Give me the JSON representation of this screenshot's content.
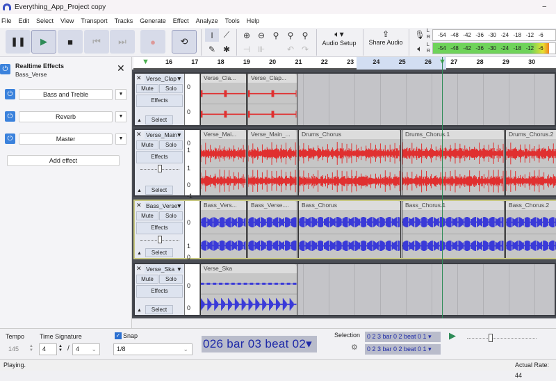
{
  "window": {
    "title": "Everything_App_Project copy",
    "minimize": "–"
  },
  "menu": [
    "File",
    "Edit",
    "Select",
    "View",
    "Transport",
    "Tracks",
    "Generate",
    "Effect",
    "Analyze",
    "Tools",
    "Help"
  ],
  "toolbar": {
    "audio_setup": "Audio Setup",
    "share_audio": "Share Audio",
    "meter_ticks": [
      "-54",
      "-48",
      "-42",
      "-36",
      "-30",
      "-24",
      "-18",
      "-12",
      "-6"
    ],
    "meter_channels": [
      "L",
      "R"
    ],
    "playback_level": 0.95
  },
  "ruler": {
    "ticks": [
      "16",
      "17",
      "18",
      "19",
      "20",
      "21",
      "22",
      "23",
      "24",
      "25",
      "26",
      "27",
      "28",
      "29",
      "30"
    ]
  },
  "realtime_effects": {
    "title": "Realtime Effects",
    "track": "Bass_Verse",
    "effects": [
      "Bass and Treble",
      "Reverb",
      "Master"
    ],
    "add_effect": "Add effect"
  },
  "tracks": [
    {
      "name": "Verse_Clap",
      "color": "#e03030",
      "mute": "Mute",
      "solo": "Solo",
      "effects": "Effects",
      "select": "Select",
      "scale": [
        "0",
        "0"
      ],
      "clips": [
        "Verse_Cla...",
        "Verse_Clap..."
      ]
    },
    {
      "name": "Verse_Main",
      "color": "#e03030",
      "mute": "Mute",
      "solo": "Solo",
      "effects": "Effects",
      "select": "Select",
      "scale": [
        "1",
        "0",
        "1",
        "0",
        "-1"
      ],
      "clips": [
        "Verse_Mai...",
        "Verse_Main_...",
        "Drums_Chorus",
        "Drums_Chorus.1",
        "Drums_Chorus.2"
      ]
    },
    {
      "name": "Bass_Verse",
      "color": "#3a3ad8",
      "mute": "Mute",
      "solo": "Solo",
      "effects": "Effects",
      "select": "Select",
      "scale": [
        "0",
        "1",
        "0"
      ],
      "clips": [
        "Bass_Vers...",
        "Bass_Verse....",
        "Bass_Chorus",
        "Bass_Chorus.1",
        "Bass_Chorus.2"
      ]
    },
    {
      "name": "Verse_Ska",
      "color": "#3a3ad8",
      "mute": "Mute",
      "solo": "Solo",
      "effects": "Effects",
      "select": "Select",
      "scale": [
        "0",
        "0"
      ],
      "clips": [
        "Verse_Ska"
      ]
    }
  ],
  "bottom": {
    "tempo_label": "Tempo",
    "tempo": "145",
    "timesig_label": "Time Signature",
    "timesig_num": "4",
    "timesig_sep": "/",
    "timesig_den": "4",
    "snap_label": "Snap",
    "snap_checked": true,
    "snap_value": "1/8",
    "time": "026 bar 03 beat 02",
    "selection_label": "Selection",
    "sel_start": "0 2 3 bar 0 2 beat 0 1",
    "sel_end": "0 2 3 bar 0 2 beat 0 1"
  },
  "status": {
    "text": "Playing.",
    "rate": "Actual Rate: 44"
  }
}
